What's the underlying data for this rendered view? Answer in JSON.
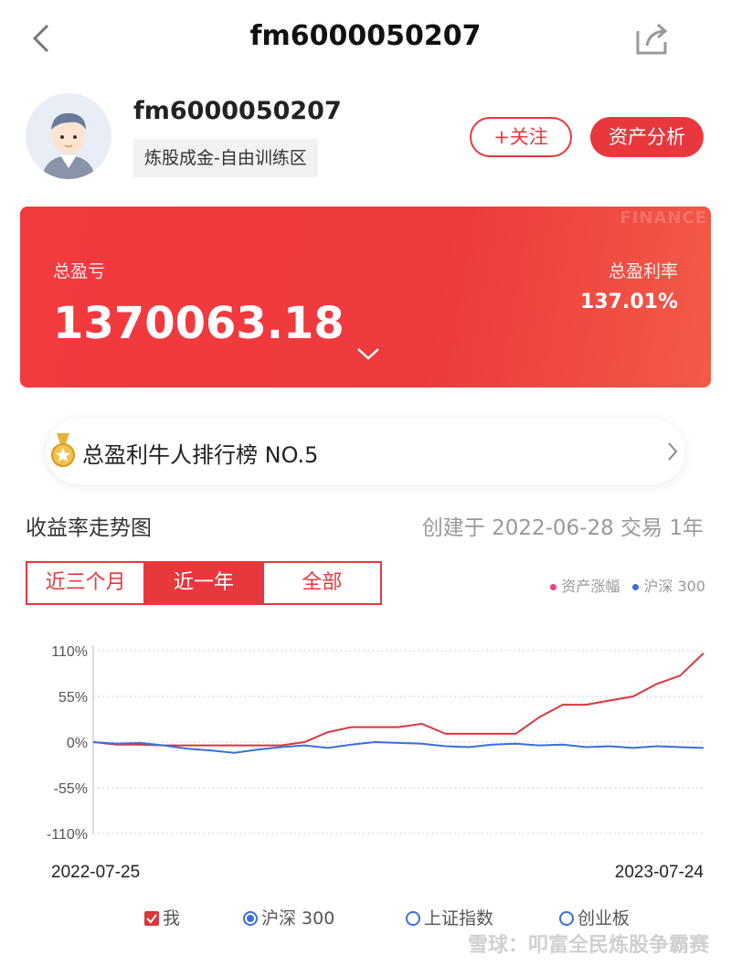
{
  "nav": {
    "title": "fm6000050207"
  },
  "profile": {
    "username": "fm6000050207",
    "tag": "炼股成金-自由训练区",
    "follow_label": "+关注",
    "asset_label": "资产分析"
  },
  "pnl": {
    "watermark": "FINANCE",
    "total_label": "总盈亏",
    "total_value": "1370063.18",
    "rate_label": "总盈利率",
    "rate_value": "137.01%"
  },
  "rank": {
    "text": "总盈利牛人排行榜 NO.5"
  },
  "section": {
    "title": "收益率走势图",
    "meta": "创建于 2022-06-28 交易 1年"
  },
  "tabs": [
    {
      "label": "近三个月",
      "active": false
    },
    {
      "label": "近一年",
      "active": true
    },
    {
      "label": "全部",
      "active": false
    }
  ],
  "legend_top": [
    {
      "label": "资产涨幅",
      "color": "#e8408a"
    },
    {
      "label": "沪深 300",
      "color": "#3a6fd8"
    }
  ],
  "legend_bottom": [
    {
      "label": "我",
      "kind": "checkbox",
      "checked": true,
      "color": "#d9363e"
    },
    {
      "label": "沪深 300",
      "kind": "radio",
      "checked": true
    },
    {
      "label": "上证指数",
      "kind": "radio",
      "checked": false
    },
    {
      "label": "创业板",
      "kind": "radio",
      "checked": false
    }
  ],
  "watermark": "雪球：叩富全民炼股争霸赛",
  "chart_data": {
    "type": "line",
    "x": [
      "2022-07-25",
      "2022-08-08",
      "2022-08-22",
      "2022-09-05",
      "2022-09-19",
      "2022-10-03",
      "2022-10-17",
      "2022-10-31",
      "2022-11-14",
      "2022-11-28",
      "2022-12-12",
      "2022-12-26",
      "2023-01-09",
      "2023-01-23",
      "2023-02-06",
      "2023-02-20",
      "2023-03-06",
      "2023-03-20",
      "2023-04-03",
      "2023-04-17",
      "2023-05-01",
      "2023-05-15",
      "2023-05-29",
      "2023-06-12",
      "2023-06-26",
      "2023-07-10",
      "2023-07-24"
    ],
    "x_tick_labels": [
      "2022-07-25",
      "2023-07-24"
    ],
    "series": [
      {
        "name": "我",
        "color": "#d9363e",
        "values": [
          0,
          -3,
          -3,
          -4,
          -4,
          -4,
          -4,
          -4,
          -4,
          0,
          12,
          18,
          18,
          18,
          22,
          10,
          10,
          10,
          10,
          30,
          45,
          45,
          50,
          55,
          70,
          80,
          107
        ]
      },
      {
        "name": "沪深 300",
        "color": "#3a6fd8",
        "values": [
          0,
          -2,
          -1,
          -4,
          -8,
          -10,
          -13,
          -9,
          -6,
          -4,
          -7,
          -3,
          0,
          -1,
          -2,
          -5,
          -6,
          -3,
          -2,
          -4,
          -3,
          -6,
          -5,
          -7,
          -5,
          -6,
          -7
        ]
      }
    ],
    "ylim": [
      -110,
      110
    ],
    "y_ticks": [
      110,
      55,
      0,
      -55,
      -110
    ],
    "y_tick_labels": [
      "110%",
      "55%",
      "0%",
      "-55%",
      "-110%"
    ],
    "grid": true
  }
}
